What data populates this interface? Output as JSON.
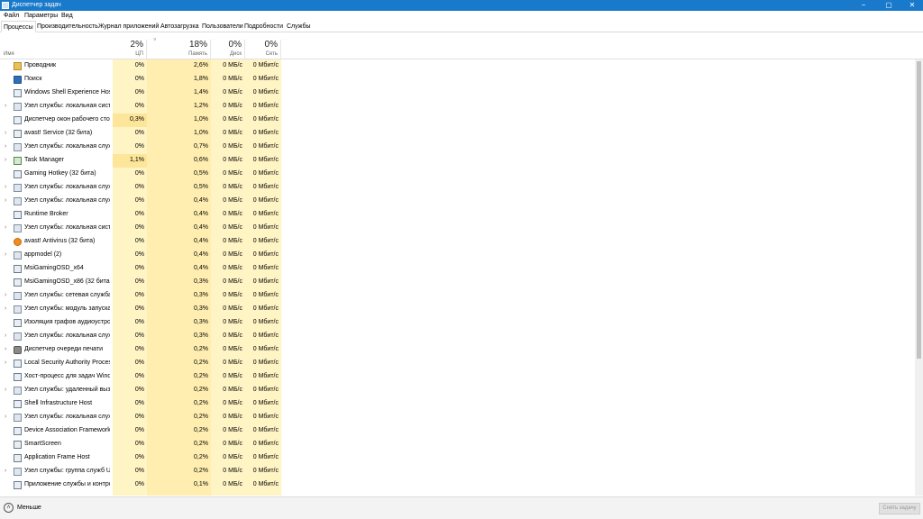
{
  "window": {
    "title": "Диспетчер задач",
    "minimize_glyph": "−",
    "maximize_glyph": "▢",
    "close_glyph": "✕"
  },
  "menu": {
    "items": [
      "Файл",
      "Параметры",
      "Вид"
    ]
  },
  "tabs": [
    "Процессы",
    "Производительность",
    "Журнал приложений",
    "Автозагрузка",
    "Пользователи",
    "Подробности",
    "Службы"
  ],
  "columns": {
    "name": {
      "label": "Имя"
    },
    "cpu": {
      "pct": "2%",
      "label": "ЦП"
    },
    "memory": {
      "pct": "18%",
      "label": "Память"
    },
    "disk": {
      "pct": "0%",
      "label": "Диск"
    },
    "network": {
      "pct": "0%",
      "label": "Сеть"
    },
    "sort_chevron": "˅"
  },
  "processes": [
    {
      "name": "Проводник",
      "icon": "folder-icon",
      "expand": "",
      "cpu": "0%",
      "memory": "2,6%",
      "disk": "0 МБ/с",
      "network": "0 Мбит/с"
    },
    {
      "name": "Поиск",
      "icon": "search-icon",
      "expand": "",
      "cpu": "0%",
      "memory": "1,8%",
      "disk": "0 МБ/с",
      "network": "0 Мбит/с"
    },
    {
      "name": "Windows Shell Experience Host",
      "icon": "app-icon",
      "expand": "",
      "cpu": "0%",
      "memory": "1,4%",
      "disk": "0 МБ/с",
      "network": "0 Мбит/с"
    },
    {
      "name": "Узел службы: локальная сист...",
      "icon": "gear-icon",
      "expand": "›",
      "cpu": "0%",
      "memory": "1,2%",
      "disk": "0 МБ/с",
      "network": "0 Мбит/с"
    },
    {
      "name": "Диспетчер окон рабочего сто...",
      "icon": "app-icon",
      "expand": "",
      "cpu": "0,3%",
      "memory": "1,0%",
      "disk": "0 МБ/с",
      "network": "0 Мбит/с"
    },
    {
      "name": "avast! Service (32 бита)",
      "icon": "app-icon",
      "expand": "›",
      "cpu": "0%",
      "memory": "1,0%",
      "disk": "0 МБ/с",
      "network": "0 Мбит/с"
    },
    {
      "name": "Узел службы: локальная служ...",
      "icon": "gear-icon",
      "expand": "›",
      "cpu": "0%",
      "memory": "0,7%",
      "disk": "0 МБ/с",
      "network": "0 Мбит/с"
    },
    {
      "name": "Task Manager",
      "icon": "task-manager-icon",
      "expand": "›",
      "cpu": "1,1%",
      "memory": "0,6%",
      "disk": "0 МБ/с",
      "network": "0 Мбит/с"
    },
    {
      "name": "Gaming Hotkey (32 бита)",
      "icon": "app-icon",
      "expand": "",
      "cpu": "0%",
      "memory": "0,5%",
      "disk": "0 МБ/с",
      "network": "0 Мбит/с"
    },
    {
      "name": "Узел службы: локальная служ...",
      "icon": "gear-icon",
      "expand": "›",
      "cpu": "0%",
      "memory": "0,5%",
      "disk": "0 МБ/с",
      "network": "0 Мбит/с"
    },
    {
      "name": "Узел службы: локальная служ...",
      "icon": "gear-icon",
      "expand": "›",
      "cpu": "0%",
      "memory": "0,4%",
      "disk": "0 МБ/с",
      "network": "0 Мбит/с"
    },
    {
      "name": "Runtime Broker",
      "icon": "app-icon",
      "expand": "",
      "cpu": "0%",
      "memory": "0,4%",
      "disk": "0 МБ/с",
      "network": "0 Мбит/с"
    },
    {
      "name": "Узел службы: локальная сист...",
      "icon": "gear-icon",
      "expand": "›",
      "cpu": "0%",
      "memory": "0,4%",
      "disk": "0 МБ/с",
      "network": "0 Мбит/с"
    },
    {
      "name": "avast! Antivirus (32 бита)",
      "icon": "avast-icon",
      "expand": "",
      "cpu": "0%",
      "memory": "0,4%",
      "disk": "0 МБ/с",
      "network": "0 Мбит/с"
    },
    {
      "name": "appmodel (2)",
      "icon": "gear-icon",
      "expand": "›",
      "cpu": "0%",
      "memory": "0,4%",
      "disk": "0 МБ/с",
      "network": "0 Мбит/с"
    },
    {
      "name": "MsiGamingOSD_x64",
      "icon": "app-icon",
      "expand": "",
      "cpu": "0%",
      "memory": "0,4%",
      "disk": "0 МБ/с",
      "network": "0 Мбит/с"
    },
    {
      "name": "MsiGamingOSD_x86 (32 бита)",
      "icon": "app-icon",
      "expand": "",
      "cpu": "0%",
      "memory": "0,3%",
      "disk": "0 МБ/с",
      "network": "0 Мбит/с"
    },
    {
      "name": "Узел службы: сетевая служба ...",
      "icon": "gear-icon",
      "expand": "›",
      "cpu": "0%",
      "memory": "0,3%",
      "disk": "0 МБ/с",
      "network": "0 Мбит/с"
    },
    {
      "name": "Узел службы: модуль запуска ...",
      "icon": "gear-icon",
      "expand": "›",
      "cpu": "0%",
      "memory": "0,3%",
      "disk": "0 МБ/с",
      "network": "0 Мбит/с"
    },
    {
      "name": "Изоляция графов аудиоустро...",
      "icon": "app-icon",
      "expand": "",
      "cpu": "0%",
      "memory": "0,3%",
      "disk": "0 МБ/с",
      "network": "0 Мбит/с"
    },
    {
      "name": "Узел службы: локальная служ...",
      "icon": "gear-icon",
      "expand": "›",
      "cpu": "0%",
      "memory": "0,3%",
      "disk": "0 МБ/с",
      "network": "0 Мбит/с"
    },
    {
      "name": "Диспетчер очереди печати",
      "icon": "printer-icon",
      "expand": "›",
      "cpu": "0%",
      "memory": "0,2%",
      "disk": "0 МБ/с",
      "network": "0 Мбит/с"
    },
    {
      "name": "Local Security Authority Proces...",
      "icon": "app-icon",
      "expand": "›",
      "cpu": "0%",
      "memory": "0,2%",
      "disk": "0 МБ/с",
      "network": "0 Мбит/с"
    },
    {
      "name": "Хост-процесс для задач Wind...",
      "icon": "app-icon",
      "expand": "",
      "cpu": "0%",
      "memory": "0,2%",
      "disk": "0 МБ/с",
      "network": "0 Мбит/с"
    },
    {
      "name": "Узел службы: удаленный выз...",
      "icon": "gear-icon",
      "expand": "›",
      "cpu": "0%",
      "memory": "0,2%",
      "disk": "0 МБ/с",
      "network": "0 Мбит/с"
    },
    {
      "name": "Shell Infrastructure Host",
      "icon": "app-icon",
      "expand": "",
      "cpu": "0%",
      "memory": "0,2%",
      "disk": "0 МБ/с",
      "network": "0 Мбит/с"
    },
    {
      "name": "Узел службы: локальная служ...",
      "icon": "gear-icon",
      "expand": "›",
      "cpu": "0%",
      "memory": "0,2%",
      "disk": "0 МБ/с",
      "network": "0 Мбит/с"
    },
    {
      "name": "Device Association Framework ...",
      "icon": "app-icon",
      "expand": "",
      "cpu": "0%",
      "memory": "0,2%",
      "disk": "0 МБ/с",
      "network": "0 Мбит/с"
    },
    {
      "name": "SmartScreen",
      "icon": "app-icon",
      "expand": "",
      "cpu": "0%",
      "memory": "0,2%",
      "disk": "0 МБ/с",
      "network": "0 Мбит/с"
    },
    {
      "name": "Application Frame Host",
      "icon": "app-icon",
      "expand": "",
      "cpu": "0%",
      "memory": "0,2%",
      "disk": "0 МБ/с",
      "network": "0 Мбит/с"
    },
    {
      "name": "Узел службы: группа служб Uni...",
      "icon": "gear-icon",
      "expand": "›",
      "cpu": "0%",
      "memory": "0,2%",
      "disk": "0 МБ/с",
      "network": "0 Мбит/с"
    },
    {
      "name": "Приложение службы и контро...",
      "icon": "app-icon",
      "expand": "",
      "cpu": "0%",
      "memory": "0,1%",
      "disk": "0 МБ/с",
      "network": "0 Мбит/с"
    }
  ],
  "footer": {
    "less_label": "Меньше",
    "less_glyph": "˄",
    "end_task_label": "Снять задачу"
  },
  "colors": {
    "titlebar": "#1979ca",
    "heat_light": "#fff4c4",
    "heat_mem": "#ffeeb0",
    "heat_active": "#fde59a"
  }
}
